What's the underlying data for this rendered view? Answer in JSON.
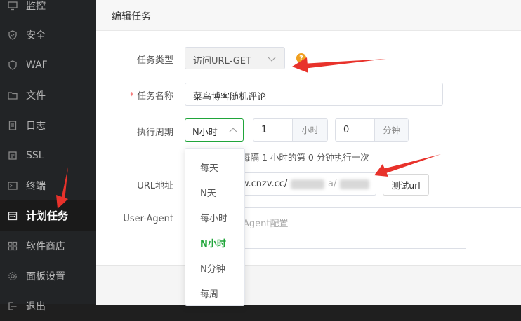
{
  "sidebar": {
    "items": [
      {
        "label": "监控",
        "icon": "monitor-icon"
      },
      {
        "label": "安全",
        "icon": "shield-icon"
      },
      {
        "label": "WAF",
        "icon": "waf-icon"
      },
      {
        "label": "文件",
        "icon": "folder-icon"
      },
      {
        "label": "日志",
        "icon": "log-icon"
      },
      {
        "label": "SSL",
        "icon": "ssl-icon"
      },
      {
        "label": "终端",
        "icon": "terminal-icon"
      },
      {
        "label": "计划任务",
        "icon": "calendar-icon",
        "active": true
      },
      {
        "label": "软件商店",
        "icon": "grid-icon"
      },
      {
        "label": "面板设置",
        "icon": "gear-icon"
      },
      {
        "label": "退出",
        "icon": "logout-icon"
      }
    ]
  },
  "dialog": {
    "title": "编辑任务",
    "task_type": {
      "label": "任务类型",
      "value": "访问URL-GET",
      "help": "?"
    },
    "task_name": {
      "label": "任务名称",
      "required_mark": "*",
      "value": "菜鸟博客随机评论"
    },
    "cycle": {
      "label": "执行周期",
      "selected": "N小时",
      "hours_value": "1",
      "hours_unit": "小时",
      "minutes_value": "0",
      "minutes_unit": "分钟",
      "hint": "每隔 1 小时的第 0 分钟执行一次"
    },
    "url": {
      "label": "URL地址",
      "value": "w.cnzv.cc/",
      "value_tail": "a/",
      "test_button": "测试url"
    },
    "user_agent": {
      "label": "User-Agent",
      "placeholder_tail": "Agent配置"
    }
  },
  "dropdown": {
    "options": [
      "每天",
      "N天",
      "每小时",
      "N小时",
      "N分钟",
      "每周"
    ],
    "selected": "N小时"
  },
  "colors": {
    "accent": "#20a53a",
    "annotation_arrow": "#e8322b",
    "required": "#f56c6c"
  }
}
